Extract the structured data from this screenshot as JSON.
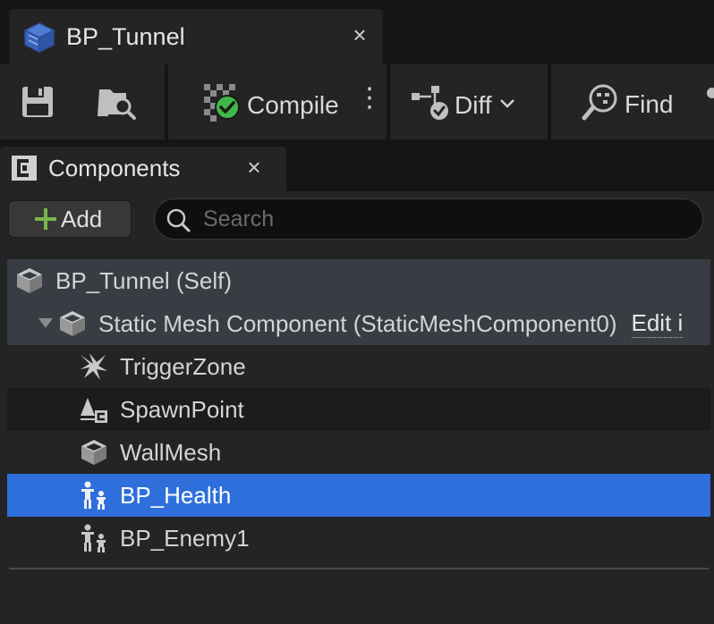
{
  "document_tab": {
    "title": "BP_Tunnel",
    "close": "×"
  },
  "toolbar": {
    "compile_label": "Compile",
    "more": "⋮",
    "diff_label": "Diff",
    "find_label": "Find"
  },
  "components_panel": {
    "tab_title": "Components",
    "close": "×",
    "add_label": "Add",
    "search_placeholder": "Search"
  },
  "tree": {
    "root": {
      "label": "BP_Tunnel (Self)",
      "icon": "blueprint-cube-icon"
    },
    "mesh": {
      "label": "Static Mesh Component (StaticMeshComponent0)",
      "edit_link": "Edit i",
      "icon": "static-mesh-icon"
    },
    "children": [
      {
        "label": "TriggerZone",
        "icon": "trigger-icon"
      },
      {
        "label": "SpawnPoint",
        "icon": "spawn-point-icon"
      },
      {
        "label": "WallMesh",
        "icon": "static-mesh-icon"
      },
      {
        "label": "BP_Health",
        "icon": "actor-icon",
        "selected": true
      },
      {
        "label": "BP_Enemy1",
        "icon": "actor-icon"
      }
    ]
  },
  "colors": {
    "selection": "#2f6fdc",
    "compile_ok": "#3fb948",
    "add_plus": "#7ab648"
  }
}
